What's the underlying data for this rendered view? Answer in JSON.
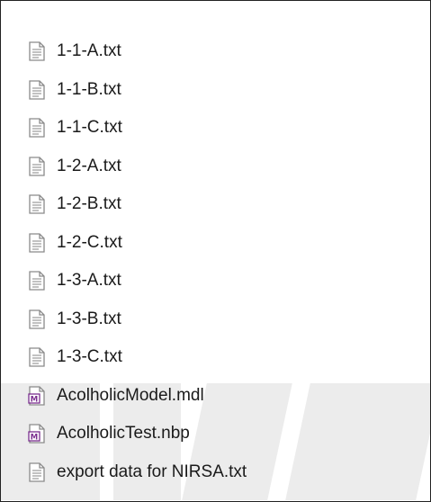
{
  "files": [
    {
      "name": "1-1-A.txt",
      "icon": "text-file-icon"
    },
    {
      "name": "1-1-B.txt",
      "icon": "text-file-icon"
    },
    {
      "name": "1-1-C.txt",
      "icon": "text-file-icon"
    },
    {
      "name": "1-2-A.txt",
      "icon": "text-file-icon"
    },
    {
      "name": "1-2-B.txt",
      "icon": "text-file-icon"
    },
    {
      "name": "1-2-C.txt",
      "icon": "text-file-icon"
    },
    {
      "name": "1-3-A.txt",
      "icon": "text-file-icon"
    },
    {
      "name": "1-3-B.txt",
      "icon": "text-file-icon"
    },
    {
      "name": "1-3-C.txt",
      "icon": "text-file-icon"
    },
    {
      "name": "AcolholicModel.mdl",
      "icon": "model-file-icon"
    },
    {
      "name": "AcolholicTest.nbp",
      "icon": "model-file-icon"
    },
    {
      "name": "export data for NIRSA.txt",
      "icon": "text-file-icon"
    }
  ],
  "colors": {
    "text": "#1a1a1a",
    "border": "#222222",
    "model_icon": "#7b2f8f",
    "watermark": "#c8c8c8"
  }
}
